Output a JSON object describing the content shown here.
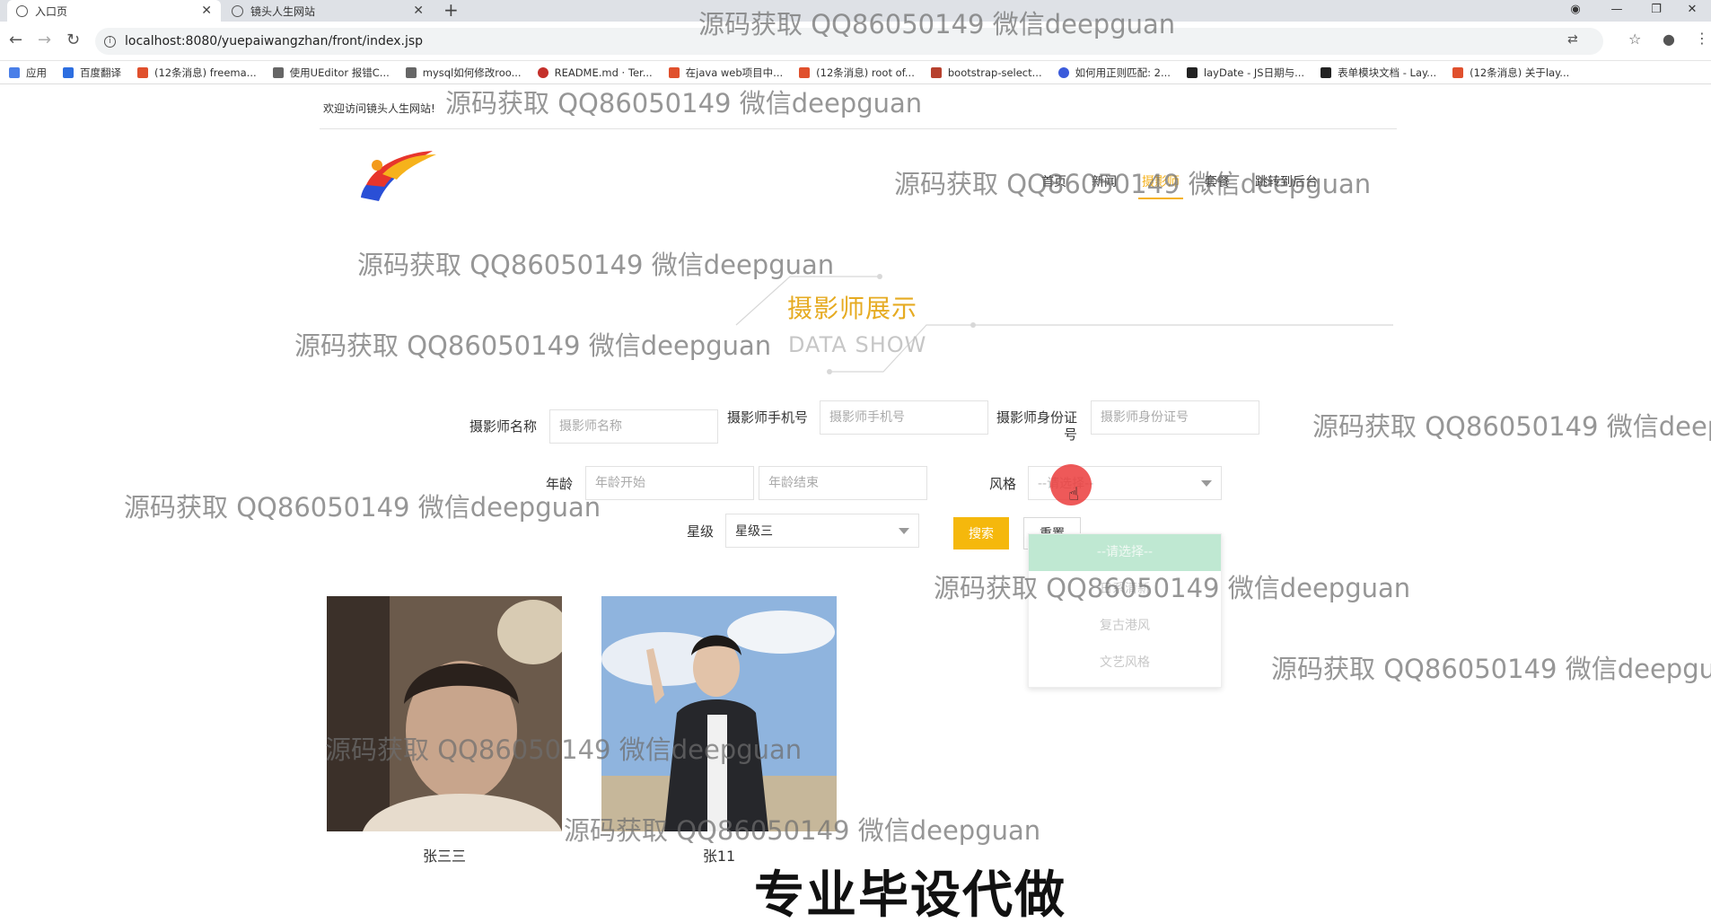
{
  "browser": {
    "tabs": [
      {
        "title": "入口页",
        "active": true
      },
      {
        "title": "镜头人生网站",
        "active": false
      }
    ],
    "url": "localhost:8080/yuepaiwangzhan/front/index.jsp",
    "bookmarks": [
      "应用",
      "百度翻译",
      "(12条消息) freema...",
      "使用UEditor 报错C...",
      "mysql如何修改roo...",
      "README.md · Ter...",
      "在java web项目中...",
      "(12条消息) root of...",
      "bootstrap-select...",
      "如何用正则匹配: 2...",
      "layDate - JS日期与...",
      "表单模块文档 - Lay...",
      "(12条消息) 关于lay..."
    ]
  },
  "header": {
    "welcome": "欢迎访问镜头人生网站!",
    "nav": [
      {
        "label": "首页",
        "active": false
      },
      {
        "label": "新闻",
        "active": false
      },
      {
        "label": "摄影师",
        "active": true
      },
      {
        "label": "套餐",
        "active": false
      },
      {
        "label": "跳转到后台",
        "active": false
      }
    ]
  },
  "section": {
    "title": "摄影师展示",
    "subtitle": "DATA SHOW"
  },
  "form": {
    "name": {
      "label": "摄影师名称",
      "placeholder": "摄影师名称"
    },
    "phone": {
      "label": "摄影师手机号",
      "placeholder": "摄影师手机号"
    },
    "idcard": {
      "label": "摄影师身份证号",
      "placeholder": "摄影师身份证号"
    },
    "age": {
      "label": "年龄",
      "start_placeholder": "年龄开始",
      "end_placeholder": "年龄结束"
    },
    "style": {
      "label": "风格",
      "value": "--请选择--",
      "options": [
        "--请选择--",
        "日系清新",
        "复古港风",
        "文艺风格"
      ]
    },
    "level": {
      "label": "星级",
      "value": "星级三"
    },
    "search_label": "搜索",
    "reset_label": "重置"
  },
  "photographers": [
    {
      "name": "张三三"
    },
    {
      "name": "张11"
    }
  ],
  "watermark": "源码获取 QQ86050149 微信deepguan",
  "banner": "专业毕设代做",
  "colors": {
    "accent": "#f5b80c",
    "title": "#e6ab22",
    "dropdown_selected": "#bfe8d2"
  }
}
